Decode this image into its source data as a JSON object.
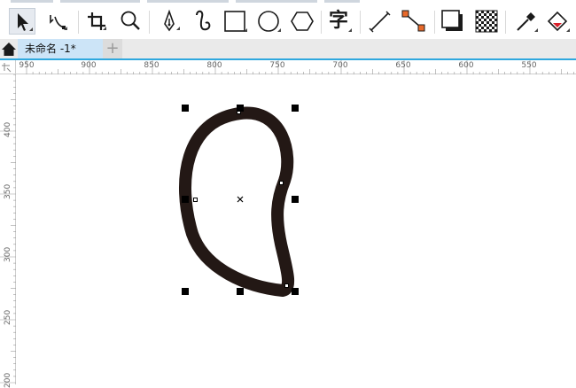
{
  "toolbar": {
    "tools": [
      {
        "id": "pick",
        "icon": "pointer-arrow-icon",
        "active": true
      },
      {
        "id": "shape",
        "icon": "node-shape-icon",
        "active": false
      },
      {
        "id": "crop",
        "icon": "crop-icon",
        "active": false
      },
      {
        "id": "zoom",
        "icon": "magnifier-icon",
        "active": false
      },
      {
        "id": "freehand",
        "icon": "pen-nib-icon",
        "active": false
      },
      {
        "id": "artistic",
        "icon": "curve-icon",
        "active": false
      },
      {
        "id": "rectangle",
        "icon": "rectangle-icon",
        "active": false
      },
      {
        "id": "ellipse",
        "icon": "ellipse-icon",
        "active": false
      },
      {
        "id": "polygon",
        "icon": "hexagon-icon",
        "active": false
      },
      {
        "id": "text",
        "icon": "text-tool-icon",
        "label": "字",
        "active": false
      },
      {
        "id": "dimension",
        "icon": "diagonal-line-icon",
        "active": false
      },
      {
        "id": "connector",
        "icon": "connector-icon",
        "active": false
      },
      {
        "id": "shadow",
        "icon": "drop-shadow-icon",
        "active": false
      },
      {
        "id": "transparency",
        "icon": "checkerboard-icon",
        "active": false
      },
      {
        "id": "eyedropper",
        "icon": "eyedropper-icon",
        "active": false
      },
      {
        "id": "fill",
        "icon": "paint-bucket-icon",
        "active": false
      }
    ]
  },
  "tabs": {
    "home_icon": "home-icon",
    "document_tab": "未命名 -1*",
    "add_tab": "+"
  },
  "rulers": {
    "horizontal_labels": [
      "950",
      "900",
      "850",
      "800",
      "750",
      "700",
      "650",
      "600",
      "550"
    ],
    "vertical_labels": [
      "400",
      "350",
      "300",
      "250",
      "200"
    ]
  },
  "colors": {
    "accent": "#2fa8de",
    "shape_outline": "#231815",
    "tab_active": "#cce4f7"
  }
}
